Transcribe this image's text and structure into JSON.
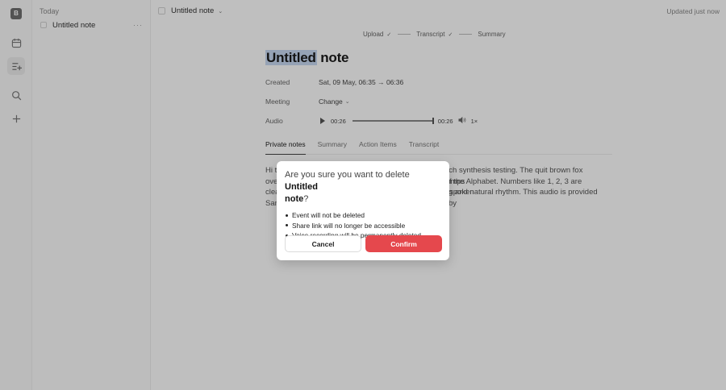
{
  "rail": {
    "logo": "B",
    "icons": [
      "calendar-icon",
      "notes-list-icon",
      "search-icon",
      "plus-icon"
    ]
  },
  "sidebar": {
    "heading": "Today",
    "items": [
      {
        "label": "Untitled note",
        "more": "···"
      }
    ]
  },
  "topbar": {
    "doc_title": "Untitled note",
    "updated": "Updated just now"
  },
  "steps": [
    {
      "label": "Upload",
      "check": "✓"
    },
    {
      "label": "Transcript",
      "check": "✓"
    },
    {
      "label": "Summary"
    }
  ],
  "note": {
    "title_highlight": "Untitled",
    "title_rest": " note",
    "props": {
      "created_label": "Created",
      "created_value": "Sat, 09 May, 06:35 → 06:36",
      "meeting_label": "Meeting",
      "meeting_value": "Change",
      "audio_label": "Audio"
    },
    "audio": {
      "current_time": "00:26",
      "total_time": "00:26",
      "speed": "1×",
      "progress": 1.0
    },
    "tabs": [
      "Private notes",
      "Summary",
      "Action Items",
      "Transcript"
    ],
    "active_tab": "Private notes",
    "body_lines": [
      "Hi t",
      "ove",
      "clea",
      "San"
    ],
    "body_right_lines": [
      "ech synthesis testing. The quit brown fox jumps",
      "f the Alphabet. Numbers like 1, 2, 3 are spoken",
      "g and natural rhythm. This audio is provided by"
    ]
  },
  "modal": {
    "prefix": "Are you sure you want to delete ",
    "name_part1": "Untitled",
    "name_part2": "note",
    "suffix": "?",
    "bullets": [
      "Event will not be deleted",
      "Share link will no longer be accessible",
      "Voice recording will be permanently deleted"
    ],
    "cancel_label": "Cancel",
    "confirm_label": "Confirm"
  },
  "colors": {
    "confirm": "#e5484d",
    "title_highlight": "#c7d8f2"
  }
}
